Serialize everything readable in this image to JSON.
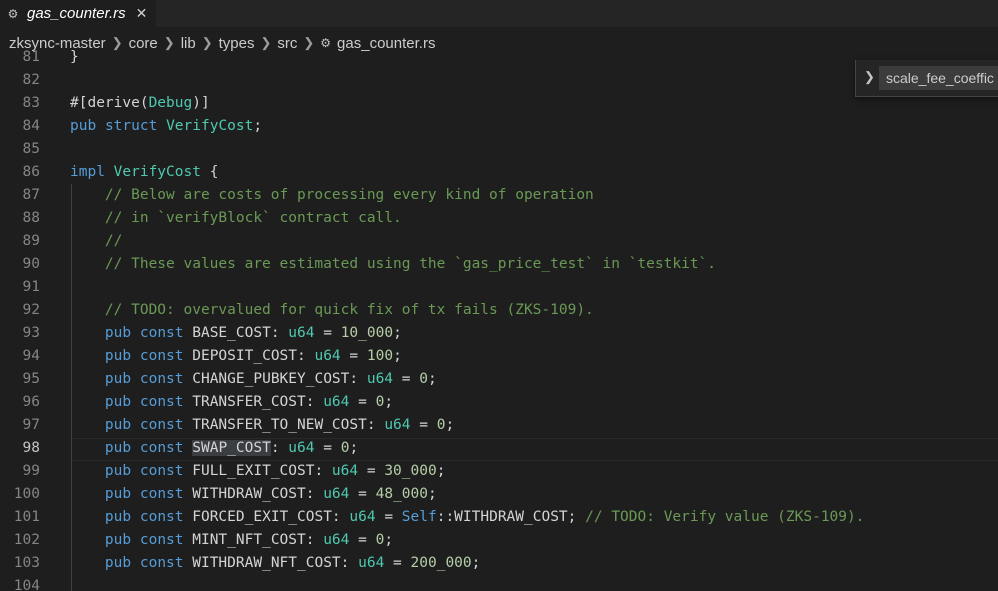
{
  "tab": {
    "title": "gas_counter.rs",
    "close_glyph": "✕",
    "icon": "rust-file-icon"
  },
  "breadcrumb": [
    "zksync-master",
    "core",
    "lib",
    "types",
    "src",
    "gas_counter.rs"
  ],
  "find_widget": {
    "value": "scale_fee_coeffic"
  },
  "editor": {
    "active_line": "98",
    "lines": [
      {
        "n": "81",
        "html": "}"
      },
      {
        "n": "82",
        "html": ""
      },
      {
        "n": "83",
        "html": "#[derive(<span class=\"t\">Debug</span>)]"
      },
      {
        "n": "84",
        "html": "<span class=\"k\">pub</span> <span class=\"k\">struct</span> <span class=\"t\">VerifyCost</span>;"
      },
      {
        "n": "85",
        "html": ""
      },
      {
        "n": "86",
        "html": "<span class=\"k\">impl</span> <span class=\"t\">VerifyCost</span> {"
      },
      {
        "n": "87",
        "html": "    <span class=\"c\">// Below are costs of processing every kind of operation</span>"
      },
      {
        "n": "88",
        "html": "    <span class=\"c\">// in `verifyBlock` contract call.</span>"
      },
      {
        "n": "89",
        "html": "    <span class=\"c\">//</span>"
      },
      {
        "n": "90",
        "html": "    <span class=\"c\">// These values are estimated using the `gas_price_test` in `testkit`.</span>"
      },
      {
        "n": "91",
        "html": ""
      },
      {
        "n": "92",
        "html": "    <span class=\"c\">// TODO: overvalued for quick fix of tx fails (ZKS-109).</span>"
      },
      {
        "n": "93",
        "html": "    <span class=\"k\">pub</span> <span class=\"k\">const</span> BASE_COST: <span class=\"t\">u64</span> = <span class=\"n\">10_000</span>;"
      },
      {
        "n": "94",
        "html": "    <span class=\"k\">pub</span> <span class=\"k\">const</span> DEPOSIT_COST: <span class=\"t\">u64</span> = <span class=\"n\">100</span>;"
      },
      {
        "n": "95",
        "html": "    <span class=\"k\">pub</span> <span class=\"k\">const</span> CHANGE_PUBKEY_COST: <span class=\"t\">u64</span> = <span class=\"n\">0</span>;"
      },
      {
        "n": "96",
        "html": "    <span class=\"k\">pub</span> <span class=\"k\">const</span> TRANSFER_COST: <span class=\"t\">u64</span> = <span class=\"n\">0</span>;"
      },
      {
        "n": "97",
        "html": "    <span class=\"k\">pub</span> <span class=\"k\">const</span> TRANSFER_TO_NEW_COST: <span class=\"t\">u64</span> = <span class=\"n\">0</span>;"
      },
      {
        "n": "98",
        "html": "    <span class=\"k\">pub</span> <span class=\"k\">const</span> <span class=\"hl\">SWAP_COST</span>: <span class=\"t\">u64</span> = <span class=\"n\">0</span>;"
      },
      {
        "n": "99",
        "html": "    <span class=\"k\">pub</span> <span class=\"k\">const</span> FULL_EXIT_COST: <span class=\"t\">u64</span> = <span class=\"n\">30_000</span>;"
      },
      {
        "n": "100",
        "html": "    <span class=\"k\">pub</span> <span class=\"k\">const</span> WITHDRAW_COST: <span class=\"t\">u64</span> = <span class=\"n\">48_000</span>;"
      },
      {
        "n": "101",
        "html": "    <span class=\"k\">pub</span> <span class=\"k\">const</span> FORCED_EXIT_COST: <span class=\"t\">u64</span> = <span class=\"k\">Self</span>::WITHDRAW_COST; <span class=\"c\">// TODO: Verify value (ZKS-109).</span>"
      },
      {
        "n": "102",
        "html": "    <span class=\"k\">pub</span> <span class=\"k\">const</span> MINT_NFT_COST: <span class=\"t\">u64</span> = <span class=\"n\">0</span>;"
      },
      {
        "n": "103",
        "html": "    <span class=\"k\">pub</span> <span class=\"k\">const</span> WITHDRAW_NFT_COST: <span class=\"t\">u64</span> = <span class=\"n\">200_000</span>;"
      },
      {
        "n": "104",
        "html": ""
      }
    ]
  }
}
